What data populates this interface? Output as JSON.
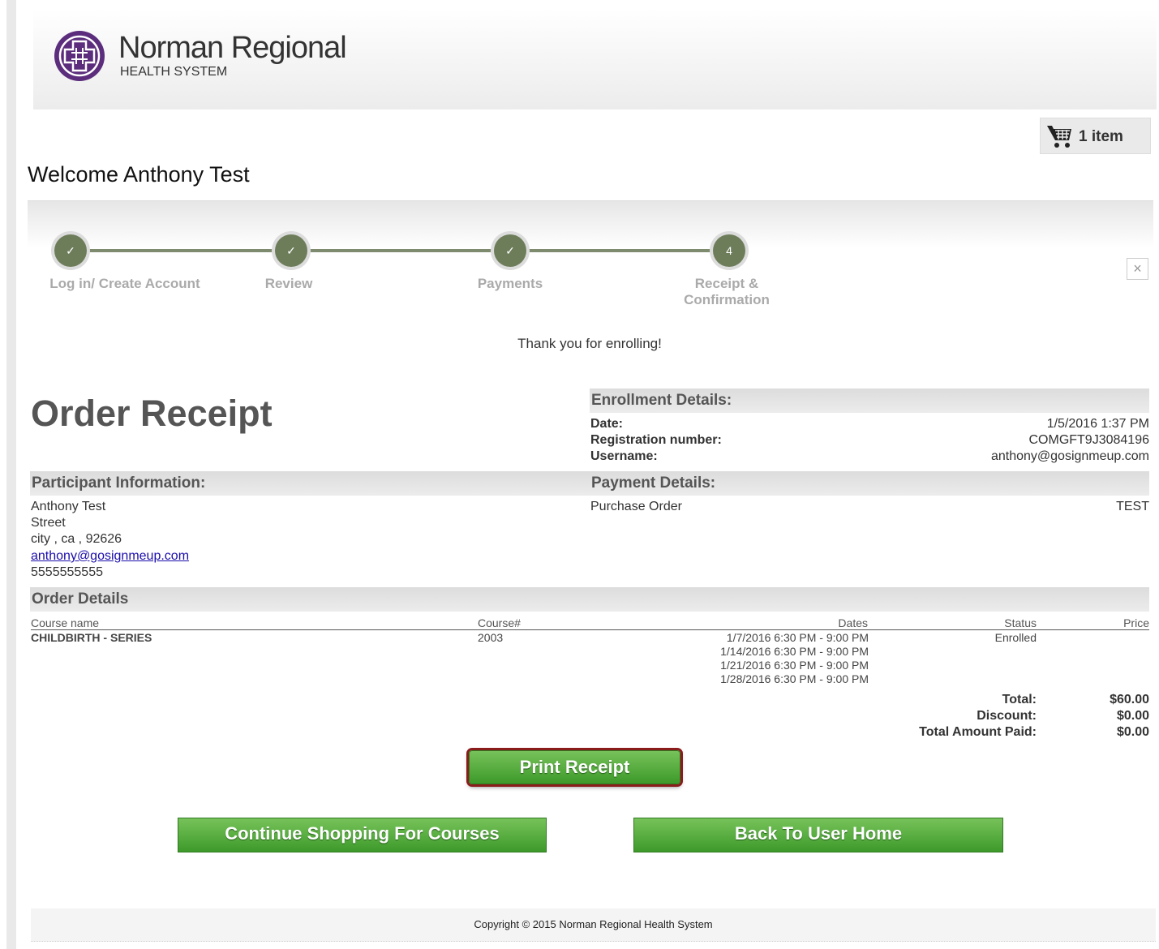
{
  "brand": {
    "name": "Norman Regional",
    "tagline": "HEALTH SYSTEM"
  },
  "cart": {
    "icon": "cart-icon",
    "label": "1 item"
  },
  "welcome": "Welcome Anthony Test",
  "steps": [
    {
      "label": "Log in/ Create Account",
      "marker": "✓",
      "state": "done"
    },
    {
      "label": "Review",
      "marker": "✓",
      "state": "done"
    },
    {
      "label": "Payments",
      "marker": "✓",
      "state": "done"
    },
    {
      "label_line1": "Receipt &",
      "label_line2": "Confirmation",
      "marker": "4",
      "state": "current"
    }
  ],
  "close_symbol": "×",
  "thanks": "Thank you for enrolling!",
  "order_title": "Order Receipt",
  "enrollment": {
    "heading": "Enrollment Details:",
    "date_label": "Date:",
    "date_value": "1/5/2016 1:37 PM",
    "reg_label": "Registration number:",
    "reg_value": "COMGFT9J3084196",
    "user_label": "Username:",
    "user_value": "anthony@gosignmeup.com"
  },
  "participant": {
    "heading": "Participant Information:",
    "name": "Anthony Test",
    "street": "Street",
    "city": "city , ca , 92626",
    "email": "anthony@gosignmeup.com",
    "phone": "5555555555"
  },
  "payment": {
    "heading": "Payment Details:",
    "method": "Purchase Order",
    "reference": "TEST"
  },
  "order": {
    "heading": "Order Details",
    "columns": {
      "course_name": "Course name",
      "course_num": "Course#",
      "dates": "Dates",
      "status": "Status",
      "price": "Price"
    },
    "rows": [
      {
        "course_name": "CHILDBIRTH - SERIES",
        "course_num": "2003",
        "dates": [
          "1/7/2016 6:30 PM - 9:00 PM",
          "1/14/2016 6:30 PM - 9:00 PM",
          "1/21/2016 6:30 PM - 9:00 PM",
          "1/28/2016 6:30 PM - 9:00 PM"
        ],
        "status": "Enrolled",
        "price": ""
      }
    ],
    "totals": [
      {
        "label": "Total:",
        "value": "$60.00"
      },
      {
        "label": "Discount:",
        "value": "$0.00"
      },
      {
        "label": "Total Amount Paid:",
        "value": "$0.00"
      }
    ]
  },
  "buttons": {
    "print": "Print Receipt",
    "continue": "Continue Shopping For Courses",
    "home": "Back To User Home"
  },
  "footer": "Copyright © 2015 Norman Regional Health System"
}
